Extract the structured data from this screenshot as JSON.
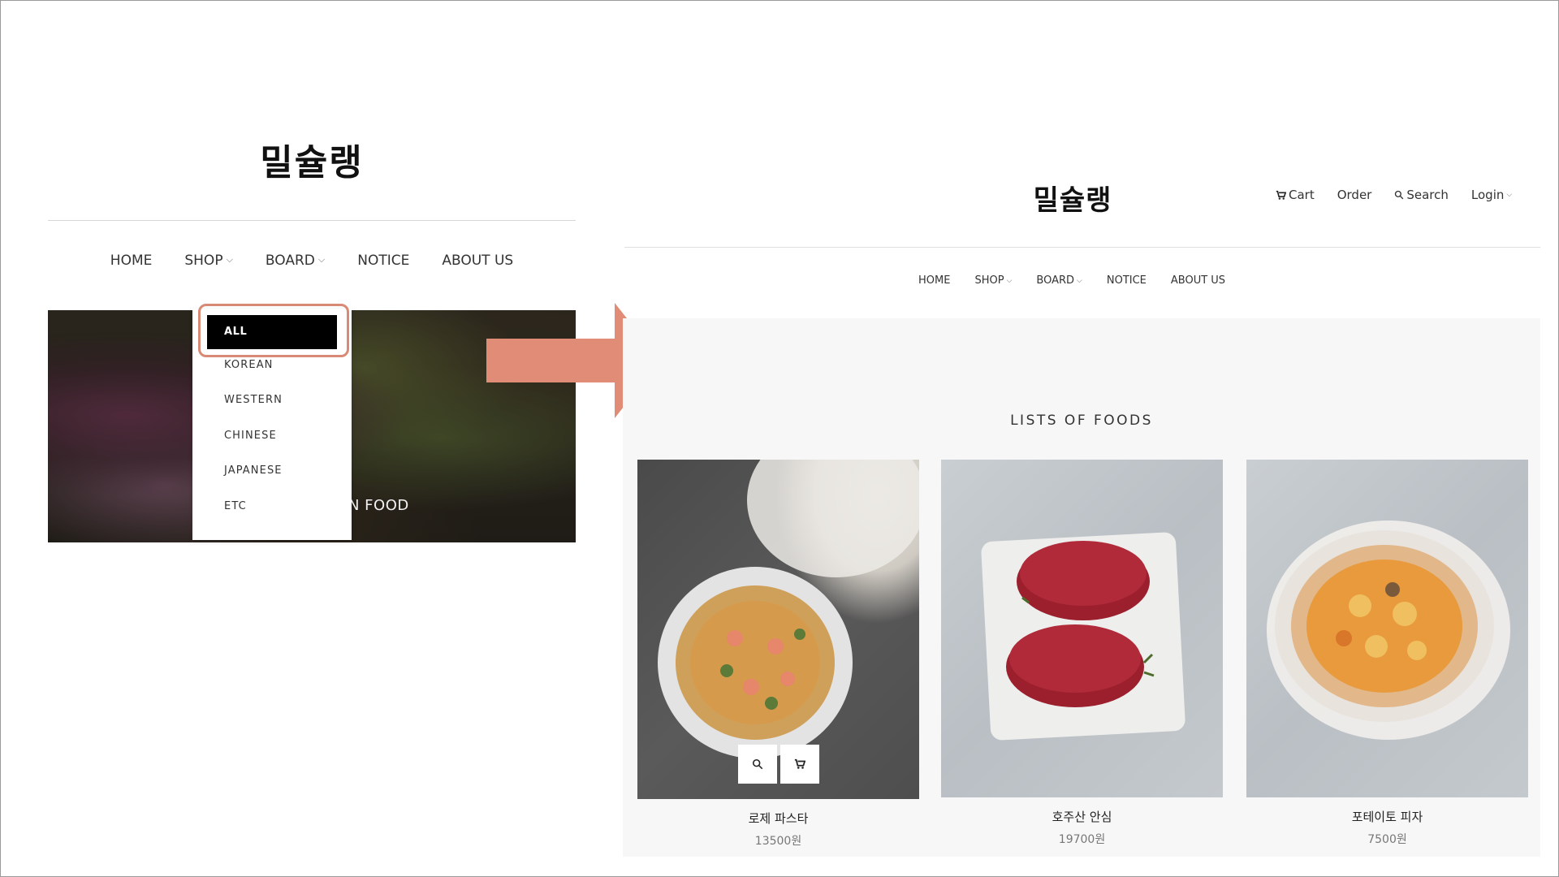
{
  "left": {
    "logo": "밀슐랭",
    "nav": [
      {
        "label": "HOME",
        "has_dropdown": false
      },
      {
        "label": "SHOP",
        "has_dropdown": true
      },
      {
        "label": "BOARD",
        "has_dropdown": true
      },
      {
        "label": "NOTICE",
        "has_dropdown": false
      },
      {
        "label": "ABOUT US",
        "has_dropdown": false
      }
    ],
    "hero_caption": "N FOOD",
    "dropdown": {
      "selected": "ALL",
      "items": [
        "KOREAN",
        "WESTERN",
        "CHINESE",
        "JAPANESE",
        "ETC"
      ]
    }
  },
  "right": {
    "logo": "밀슐랭",
    "util_nav": {
      "cart": "Cart",
      "order": "Order",
      "search": "Search",
      "login": "Login"
    },
    "nav": [
      {
        "label": "HOME",
        "has_dropdown": false
      },
      {
        "label": "SHOP",
        "has_dropdown": true
      },
      {
        "label": "BOARD",
        "has_dropdown": true
      },
      {
        "label": "NOTICE",
        "has_dropdown": false
      },
      {
        "label": "ABOUT US",
        "has_dropdown": false
      }
    ],
    "section_title": "LISTS OF FOODS",
    "products": [
      {
        "name": "로제 파스타",
        "price": "13500원"
      },
      {
        "name": "호주산 안심",
        "price": "19700원"
      },
      {
        "name": "포테이토 피자",
        "price": "7500원"
      }
    ]
  },
  "colors": {
    "highlight": "#d98a76",
    "arrow": "#e08c77",
    "selected_bg": "#000000",
    "section_bg": "#f7f7f7"
  }
}
